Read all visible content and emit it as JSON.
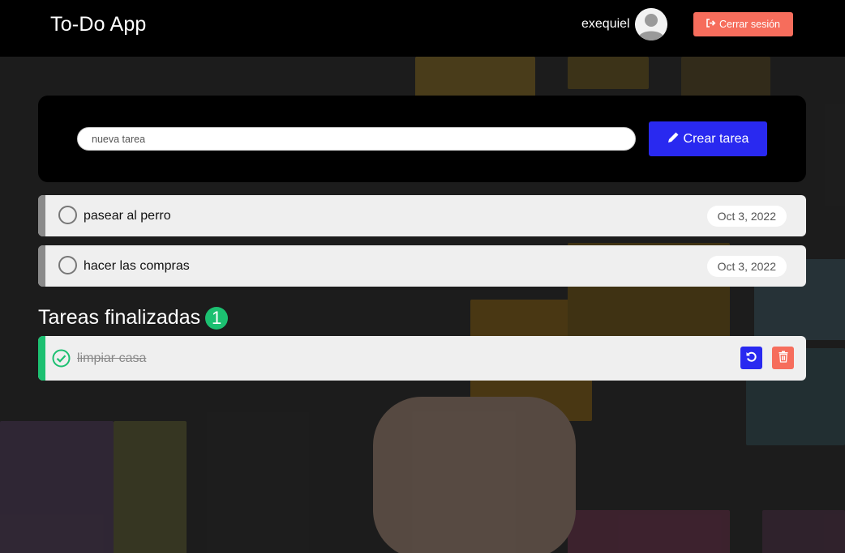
{
  "navbar": {
    "brand": "To-Do App",
    "username": "exequiel",
    "logout_label": "Cerrar sesión"
  },
  "create": {
    "placeholder": "nueva tarea",
    "button_label": "Crear tarea"
  },
  "pending_tasks": [
    {
      "title": "pasear al perro",
      "date": "Oct 3, 2022"
    },
    {
      "title": "hacer las compras",
      "date": "Oct 3, 2022"
    }
  ],
  "finished": {
    "heading": "Tareas finalizadas",
    "count": "1",
    "tasks": [
      {
        "title": "limpiar casa"
      }
    ]
  },
  "colors": {
    "accent_blue": "#2929f0",
    "logout_red": "#f66d5c",
    "done_green": "#1cc071"
  },
  "icons": {
    "logout": "sign-out-icon",
    "create": "pencil-icon",
    "pending_status": "empty-circle-icon",
    "done_status": "check-circle-icon",
    "restore": "undo-icon",
    "delete": "trash-icon",
    "avatar": "user-avatar-icon"
  }
}
